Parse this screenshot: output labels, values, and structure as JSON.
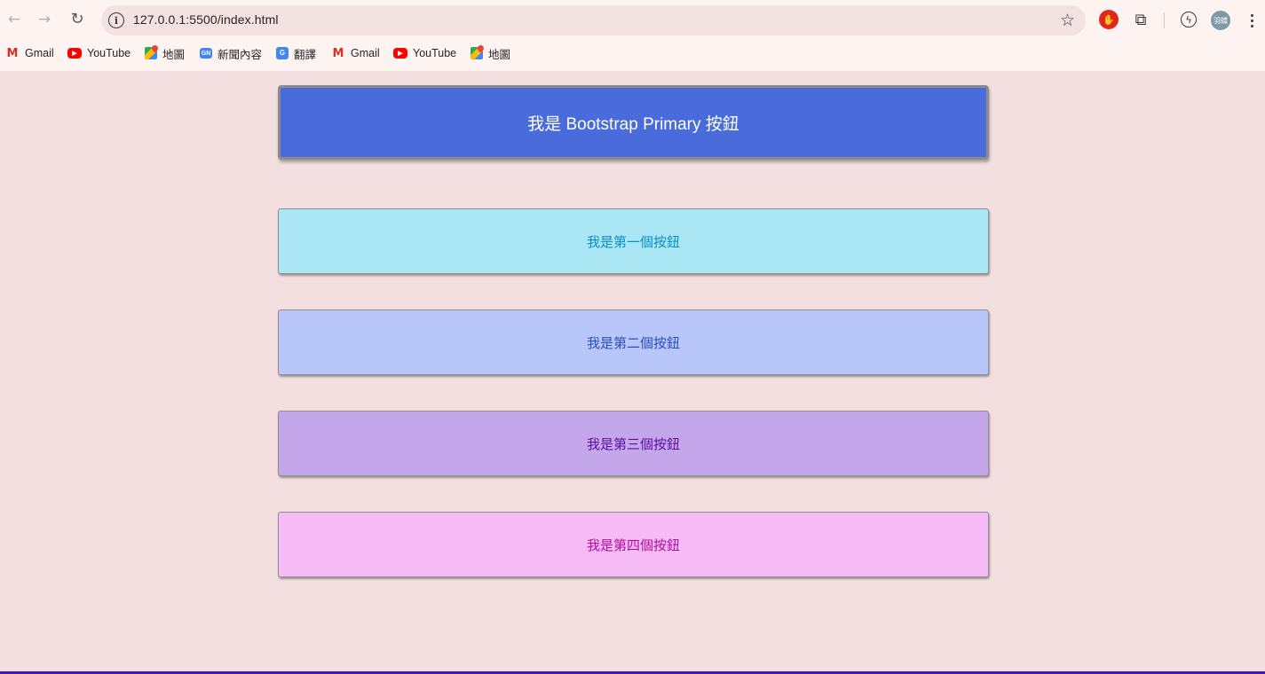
{
  "browser": {
    "url": "127.0.0.1:5500/index.html",
    "back_glyph": "←",
    "forward_glyph": "→",
    "reload_glyph": "↻",
    "info_glyph": "i",
    "star_glyph": "☆",
    "avatar_text": "羽蝶",
    "bookmarks": [
      {
        "label": "Gmail",
        "icon": "gmail-icon"
      },
      {
        "label": "YouTube",
        "icon": "youtube-icon"
      },
      {
        "label": "地圖",
        "icon": "maps-icon"
      },
      {
        "label": "新聞內容",
        "icon": "news-icon"
      },
      {
        "label": "翻譯",
        "icon": "translate-icon"
      },
      {
        "label": "Gmail",
        "icon": "gmail-icon"
      },
      {
        "label": "YouTube",
        "icon": "youtube-icon"
      },
      {
        "label": "地圖",
        "icon": "maps-icon"
      }
    ]
  },
  "page": {
    "primary_button": "我是 Bootstrap Primary 按鈕",
    "buttons": [
      {
        "label": "我是第一個按鈕",
        "color": "#aae6f3"
      },
      {
        "label": "我是第二個按鈕",
        "color": "#b9c6f9"
      },
      {
        "label": "我是第三個按鈕",
        "color": "#c4a6ea"
      },
      {
        "label": "我是第四個按鈕",
        "color": "#f6baf6"
      }
    ],
    "primary_color": "#4a6bdc",
    "background_color": "#f3dfdf"
  }
}
